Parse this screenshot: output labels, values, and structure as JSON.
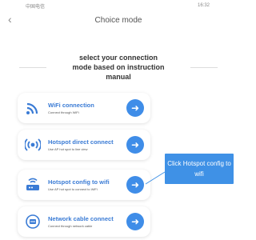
{
  "status_bar": {
    "left": "中国电信",
    "right": "16:32"
  },
  "header": {
    "back_icon": "chevron-left-icon",
    "title": "Choice mode"
  },
  "instruction": "select your connection mode based on instruction manual",
  "modes": [
    {
      "title": "WiFi connection",
      "subtitle": "Connect through WiFi",
      "icon": "wifi-icon"
    },
    {
      "title": "Hotspot direct connect",
      "subtitle": "Use AP hot spot to line view",
      "icon": "hotspot-icon"
    },
    {
      "title": "Hotspot config to wifi",
      "subtitle": "Use AP hot spot to connect to WiFi",
      "icon": "router-icon"
    },
    {
      "title": "Network cable connect",
      "subtitle": "Connect through network cable",
      "icon": "network-icon"
    }
  ],
  "tooltip": "Click Hotspot config to wifi",
  "colors": {
    "accent": "#3f8de8",
    "tooltip": "#3f91e6",
    "title_text": "#3a7bd5"
  }
}
